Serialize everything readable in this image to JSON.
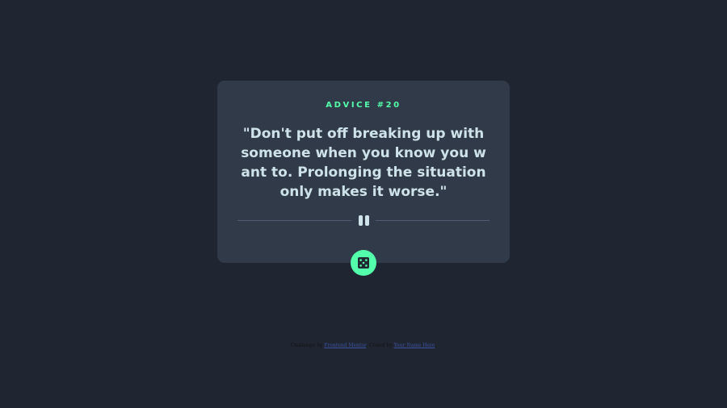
{
  "card": {
    "advice_id": "ADVICE #20",
    "advice_text": "\"Don't put off breaking up with someone when you know you want to. Prolonging the situation only makes it worse.\""
  },
  "icons": {
    "divider": "pause-icon",
    "button": "dice-icon"
  },
  "footer": {
    "prefix": "Challenge by",
    "challenge_link": "Frontend Mentor",
    "middle": ". Coded by",
    "author_link": "Your Name Here",
    "suffix": "."
  },
  "colors": {
    "background": "#1f2632",
    "card": "#313a48",
    "accent": "#53ffaa",
    "text": "#cee3e9",
    "divider": "#4f5d74"
  }
}
